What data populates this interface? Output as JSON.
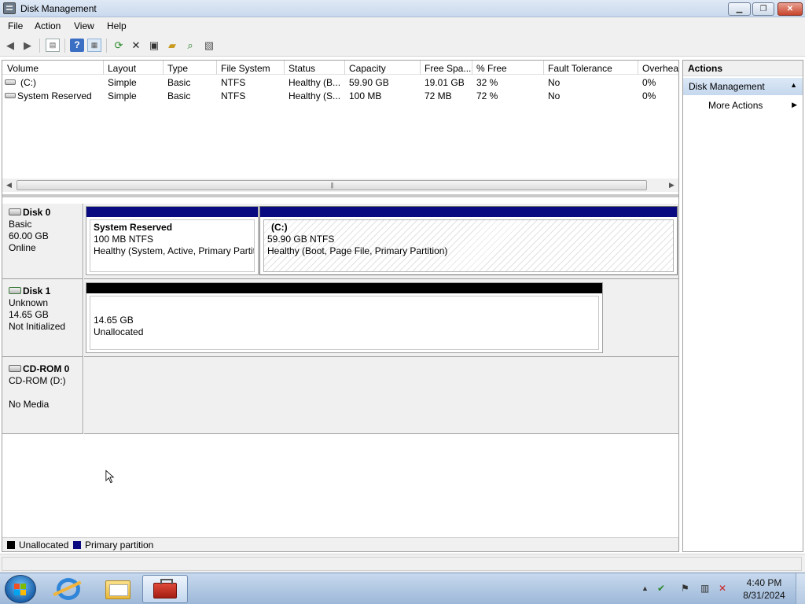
{
  "window": {
    "title": "Disk Management",
    "icon": "disk-management-icon",
    "buttons": [
      "minimize",
      "maximize",
      "close"
    ]
  },
  "menu": [
    "File",
    "Action",
    "View",
    "Help"
  ],
  "toolbar_icons": [
    "back-icon",
    "forward-icon",
    "console-tree-icon",
    "help-icon",
    "show-hide-icon",
    "refresh-icon",
    "delete-icon",
    "properties-icon",
    "open-icon",
    "search-icon",
    "rescan-icon"
  ],
  "volume_list": {
    "columns": [
      "Volume",
      "Layout",
      "Type",
      "File System",
      "Status",
      "Capacity",
      "Free Spa...",
      "% Free",
      "Fault Tolerance",
      "Overhea"
    ],
    "rows": [
      {
        "volume": "(C:)",
        "layout": "Simple",
        "type": "Basic",
        "fs": "NTFS",
        "status": "Healthy (B...",
        "capacity": "59.90 GB",
        "free": "19.01 GB",
        "pct": "32 %",
        "fault": "No",
        "overhead": "0%"
      },
      {
        "volume": "System Reserved",
        "layout": "Simple",
        "type": "Basic",
        "fs": "NTFS",
        "status": "Healthy (S...",
        "capacity": "100 MB",
        "free": "72 MB",
        "pct": "72 %",
        "fault": "No",
        "overhead": "0%"
      }
    ]
  },
  "disks": [
    {
      "name": "Disk 0",
      "type": "Basic",
      "size": "60.00 GB",
      "status": "Online",
      "partitions": [
        {
          "name": "System Reserved",
          "size": "100 MB NTFS",
          "status": "Healthy (System, Active, Primary Partiti"
        },
        {
          "name": "(C:)",
          "size": "59.90 GB NTFS",
          "status": "Healthy (Boot, Page File, Primary Partition)"
        }
      ]
    },
    {
      "name": "Disk 1",
      "type": "Unknown",
      "size": "14.65 GB",
      "status": "Not Initialized",
      "partitions": [
        {
          "size": "14.65 GB",
          "status": "Unallocated"
        }
      ]
    },
    {
      "name": "CD-ROM 0",
      "type": "CD-ROM (D:)",
      "status": "No Media"
    }
  ],
  "legend": [
    {
      "label": "Unallocated",
      "color": "#000000"
    },
    {
      "label": "Primary partition",
      "color": "#0a0a80"
    }
  ],
  "actions": {
    "header": "Actions",
    "section": "Disk Management",
    "items": [
      "More Actions"
    ]
  },
  "taskbar": {
    "time": "4:40 PM",
    "date": "8/31/2024",
    "tray_icons": [
      "show-hidden-icons-arrow",
      "action-center-icon",
      "flag-icon",
      "network-icon",
      "volume-muted-icon"
    ]
  },
  "colors": {
    "primary_partition": "#0a0a80",
    "unallocated": "#000000",
    "actions_section": "#c6d8ee"
  }
}
